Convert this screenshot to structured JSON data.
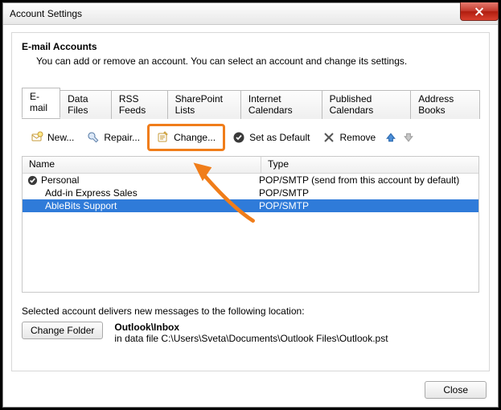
{
  "window": {
    "title": "Account Settings"
  },
  "section": {
    "heading": "E-mail Accounts",
    "sub": "You can add or remove an account. You can select an account and change its settings."
  },
  "tabs": [
    {
      "label": "E-mail",
      "active": true
    },
    {
      "label": "Data Files"
    },
    {
      "label": "RSS Feeds"
    },
    {
      "label": "SharePoint Lists"
    },
    {
      "label": "Internet Calendars"
    },
    {
      "label": "Published Calendars"
    },
    {
      "label": "Address Books"
    }
  ],
  "toolbar": {
    "new": "New...",
    "repair": "Repair...",
    "change": "Change...",
    "set_default": "Set as Default",
    "remove": "Remove"
  },
  "list": {
    "col_name": "Name",
    "col_type": "Type",
    "rows": [
      {
        "name": "Personal",
        "type": "POP/SMTP (send from this account by default)",
        "default": true,
        "selected": false
      },
      {
        "name": "Add-in Express Sales",
        "type": "POP/SMTP",
        "default": false,
        "selected": false
      },
      {
        "name": "AbleBits Support",
        "type": "POP/SMTP",
        "default": false,
        "selected": true
      }
    ]
  },
  "location": {
    "label": "Selected account delivers new messages to the following location:",
    "change_folder": "Change Folder",
    "folder": "Outlook\\Inbox",
    "datafile": "in data file C:\\Users\\Sveta\\Documents\\Outlook Files\\Outlook.pst"
  },
  "buttons": {
    "close": "Close"
  }
}
